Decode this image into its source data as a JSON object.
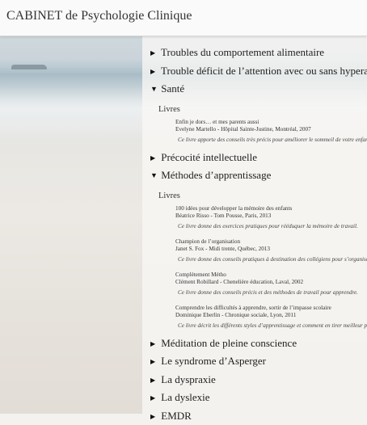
{
  "header": {
    "title": "CABINET de Psychologie Clinique"
  },
  "topics_top": [
    {
      "label": "Troubles du comportement alimentaire"
    },
    {
      "label": "Trouble déficit de l’attention avec ou sans hyperactivité"
    }
  ],
  "sante": {
    "label": "Santé",
    "section": "Livres",
    "books": [
      {
        "title": "Enfin je dors… et mes parents aussi",
        "author": "Evelyne Martello - Hôpital Sainte-Justine, Montréal, 2007",
        "desc": "Ce livre apporte des conseils très précis pour améliorer le sommeil de votre enfant."
      }
    ]
  },
  "precocite": {
    "label": "Précocité intellectuelle"
  },
  "methodes": {
    "label": "Méthodes d’apprentissage",
    "section": "Livres",
    "books": [
      {
        "title": "100 idées pour développer la mémoire des enfants",
        "author": "Béatrice Risso - Tom Pousse, Paris, 2013",
        "desc": "Ce livre donne des exercices pratiques pour rééduquer la mémoire de travail."
      },
      {
        "title": "Champion de l’organisation",
        "author": "Janet S. Fox - Midi trente, Québec, 2013",
        "desc": "Ce livre donne des conseils pratiques à destination des collégiens pour s’organiser."
      },
      {
        "title": "Complètement Métho",
        "author": "Clément Robillard - Chenelière éducation, Laval, 2002",
        "desc": "Ce livre donne des conseils précis et des méthodes de travail pour apprendre."
      },
      {
        "title": "Comprendre les difficultés à apprendre, sortir de l’impasse scolaire",
        "author": "Dominique Eberlin - Chronique sociale, Lyon, 2011",
        "desc": "Ce livre décrit les différents styles d’apprentissage et comment en tirer meilleur parti."
      }
    ]
  },
  "topics_bottom": [
    {
      "label": "Méditation de pleine conscience"
    },
    {
      "label": "Le syndrome d’Asperger"
    },
    {
      "label": "La dyspraxie"
    },
    {
      "label": "La dyslexie"
    },
    {
      "label": "EMDR"
    }
  ],
  "icons": {
    "collapsed": "arrow-right-icon",
    "expanded": "arrow-down-icon"
  }
}
